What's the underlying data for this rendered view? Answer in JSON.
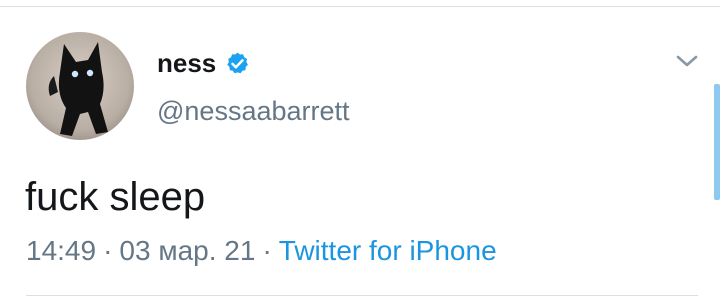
{
  "tweet": {
    "display_name": "ness",
    "handle": "@nessaabarrett",
    "text": "fuck sleep",
    "time": "14:49",
    "date": "03 мар. 21",
    "source": "Twitter for iPhone",
    "separator": "·"
  },
  "icons": {
    "avatar": "avatar",
    "verified": "verified-badge-icon",
    "more": "chevron-down-icon"
  },
  "colors": {
    "accent": "#1b95e0",
    "secondary_text": "#657786",
    "primary_text": "#14171a",
    "verified": "#1da1f2"
  }
}
